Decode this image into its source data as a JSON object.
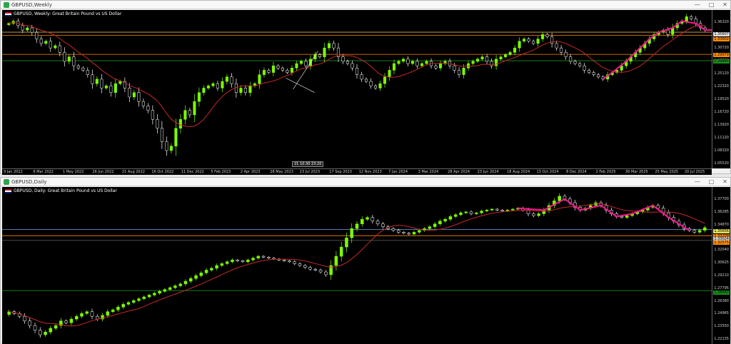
{
  "colors": {
    "bull": "#7CFC00",
    "bear": "#ffffff",
    "ma": "#c62828",
    "pattern": "#ff1493",
    "hline_orange": "#ff8c00",
    "hline_green": "#1b8f1b",
    "hline_yellow": "#d4b04a",
    "hline_blue": "#6aa0e0"
  },
  "weekly": {
    "window_title": "GBPUSD,Weekly",
    "symbol_line": "GBPUSD, Weekly: Great Britain Pound vs US Dollar",
    "crosshair": [
      "21",
      "10:30",
      "23:20"
    ],
    "price_labels": [
      "1.36320",
      "1.33700",
      "1.30720",
      "1.27290",
      "1.25120",
      "1.22320",
      "1.19520",
      "1.16720",
      "1.13920",
      "1.11120",
      "1.08320",
      "1.05520"
    ],
    "price_tags": [
      "1.35607",
      "1.33602",
      "1.29979",
      "1.26865"
    ],
    "time_labels": [
      "9 Jan 2022",
      "6 Mar 2022",
      "1 May 2022",
      "26 Jun 2022",
      "21 Aug 2022",
      "16 Oct 2022",
      "11 Dec 2022",
      "5 Feb 2023",
      "2 Apr 2023",
      "28 May 2023",
      "23 Jul 2023",
      "17 Sep 2023",
      "12 Nov 2023",
      "7 Jan 2024",
      "3 Mar 2024",
      "28 Apr 2024",
      "23 Jun 2024",
      "18 Aug 2024",
      "13 Oct 2024",
      "8 Dec 2024",
      "2 Feb 2025",
      "30 Mar 2025",
      "25 May 2025",
      "20 Jul 2025"
    ],
    "chart_data": {
      "type": "candlestick",
      "ylim": [
        1.03,
        1.385
      ],
      "close": [
        1.355,
        1.36,
        1.35,
        1.34,
        1.345,
        1.335,
        1.32,
        1.31,
        1.315,
        1.3,
        1.305,
        1.29,
        1.27,
        1.28,
        1.26,
        1.255,
        1.25,
        1.24,
        1.22,
        1.23,
        1.21,
        1.215,
        1.2,
        1.22,
        1.225,
        1.21,
        1.19,
        1.2,
        1.18,
        1.17,
        1.16,
        1.14,
        1.12,
        1.09,
        1.07,
        1.08,
        1.12,
        1.14,
        1.16,
        1.15,
        1.18,
        1.2,
        1.21,
        1.215,
        1.22,
        1.21,
        1.225,
        1.235,
        1.22,
        1.2,
        1.21,
        1.2,
        1.215,
        1.22,
        1.24,
        1.25,
        1.245,
        1.26,
        1.255,
        1.25,
        1.245,
        1.255,
        1.265,
        1.27,
        1.26,
        1.275,
        1.285,
        1.28,
        1.3,
        1.31,
        1.3,
        1.28,
        1.27,
        1.265,
        1.255,
        1.24,
        1.23,
        1.225,
        1.215,
        1.21,
        1.22,
        1.235,
        1.25,
        1.265,
        1.27,
        1.275,
        1.265,
        1.27,
        1.26,
        1.265,
        1.27,
        1.26,
        1.255,
        1.265,
        1.27,
        1.26,
        1.25,
        1.24,
        1.255,
        1.265,
        1.27,
        1.275,
        1.28,
        1.27,
        1.26,
        1.275,
        1.28,
        1.285,
        1.29,
        1.3,
        1.315,
        1.32,
        1.315,
        1.31,
        1.32,
        1.33,
        1.325,
        1.31,
        1.3,
        1.29,
        1.28,
        1.27,
        1.265,
        1.26,
        1.25,
        1.245,
        1.24,
        1.235,
        1.23,
        1.24,
        1.245,
        1.25,
        1.26,
        1.27,
        1.28,
        1.29,
        1.3,
        1.31,
        1.32,
        1.33,
        1.335,
        1.34,
        1.33,
        1.345,
        1.355,
        1.36,
        1.37,
        1.365,
        1.355,
        1.345,
        1.34
      ]
    }
  },
  "daily": {
    "window_title": "GBPUSD,Daily",
    "symbol_line": "GBPUSD, Daily: Great Britain Pound vs US Dollar",
    "price_labels": [
      "1.37700",
      "1.36285",
      "1.34870",
      "1.33455",
      "1.32040",
      "1.30625",
      "1.29210",
      "1.27795",
      "1.26380",
      "1.24965",
      "1.23550",
      "1.22135"
    ],
    "price_tags": [
      "1.35656",
      "1.33209",
      "1.33024",
      "1.32575",
      "1.26660"
    ],
    "chart_data": {
      "type": "candlestick",
      "ylim": [
        1.215,
        1.385
      ],
      "close": [
        1.25,
        1.248,
        1.245,
        1.24,
        1.235,
        1.23,
        1.225,
        1.228,
        1.232,
        1.235,
        1.24,
        1.238,
        1.242,
        1.245,
        1.248,
        1.25,
        1.245,
        1.242,
        1.246,
        1.25,
        1.252,
        1.255,
        1.258,
        1.26,
        1.262,
        1.264,
        1.266,
        1.268,
        1.27,
        1.272,
        1.274,
        1.276,
        1.278,
        1.28,
        1.283,
        1.286,
        1.289,
        1.292,
        1.295,
        1.297,
        1.3,
        1.302,
        1.304,
        1.306,
        1.305,
        1.304,
        1.306,
        1.308,
        1.31,
        1.309,
        1.308,
        1.307,
        1.306,
        1.305,
        1.304,
        1.302,
        1.3,
        1.298,
        1.296,
        1.295,
        1.293,
        1.29,
        1.3,
        1.31,
        1.32,
        1.33,
        1.34,
        1.345,
        1.35,
        1.352,
        1.348,
        1.345,
        1.342,
        1.34,
        1.338,
        1.336,
        1.335,
        1.334,
        1.336,
        1.338,
        1.34,
        1.342,
        1.345,
        1.348,
        1.35,
        1.353,
        1.355,
        1.357,
        1.358,
        1.356,
        1.357,
        1.359,
        1.36,
        1.361,
        1.36,
        1.359,
        1.36,
        1.361,
        1.362,
        1.36,
        1.356,
        1.354,
        1.356,
        1.36,
        1.365,
        1.37,
        1.375,
        1.372,
        1.368,
        1.363,
        1.36,
        1.362,
        1.365,
        1.368,
        1.365,
        1.36,
        1.356,
        1.353,
        1.352,
        1.354,
        1.356,
        1.358,
        1.36,
        1.363,
        1.365,
        1.362,
        1.357,
        1.352,
        1.348,
        1.344,
        1.34,
        1.338,
        1.336,
        1.338,
        1.341
      ]
    }
  }
}
